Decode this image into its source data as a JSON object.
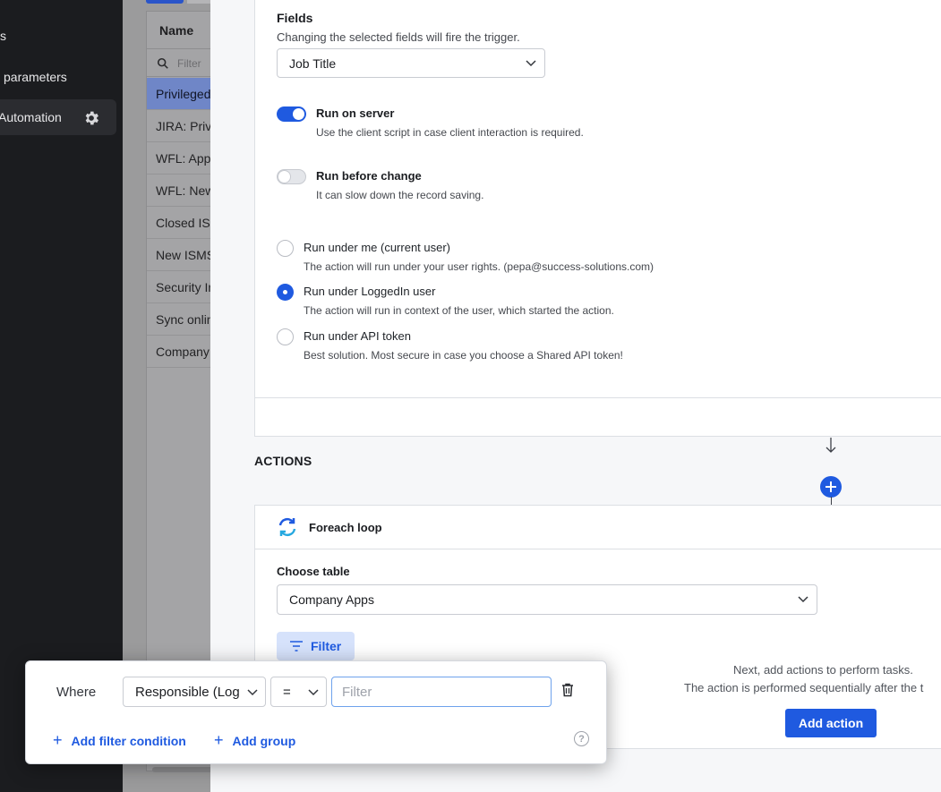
{
  "sidebar": {
    "items": [
      {
        "label": "s"
      },
      {
        "label": "parameters"
      },
      {
        "label": "Automation"
      }
    ]
  },
  "list": {
    "header": "Name",
    "filter_placeholder": "Filter",
    "rows": [
      "Privileged",
      "JIRA: Privi",
      "WFL: Appr",
      "WFL: New",
      "Closed ISM",
      "New ISMS",
      "Security In",
      "Sync onlin",
      "Company"
    ]
  },
  "trigger": {
    "fields_label": "Fields",
    "fields_hint": "Changing the selected fields will fire the trigger.",
    "fields_value": "Job Title",
    "run_on_server_label": "Run on server",
    "run_on_server_hint": "Use the client script in case client interaction is required.",
    "run_before_change_label": "Run before change",
    "run_before_change_hint": "It can slow down the record saving.",
    "run_options": [
      {
        "label": "Run under me (current user)",
        "hint": "The action will run under your user rights. (pepa@success-solutions.com)",
        "selected": false
      },
      {
        "label": "Run under LoggedIn user",
        "hint": "The action will run in context of the user, which started the action.",
        "selected": true
      },
      {
        "label": "Run under API token",
        "hint": "Best solution. Most secure in case you choose a Shared API token!",
        "selected": false
      }
    ]
  },
  "actions": {
    "title": "ACTIONS",
    "loop_title": "Foreach loop",
    "choose_table_label": "Choose table",
    "table_value": "Company Apps",
    "filter_button": "Filter",
    "next_text": "Next, add actions to perform tasks.",
    "sequential_text": "The action is performed sequentially after the t",
    "add_action_button": "Add action"
  },
  "popup": {
    "where_label": "Where",
    "field_value": "Responsible (Log",
    "operator_value": "=",
    "input_placeholder": "Filter",
    "add_condition": "Add filter condition",
    "add_group": "Add group",
    "help": "?"
  },
  "colors": {
    "accent": "#1f5ae0",
    "sidebar_bg": "#1b1c1f"
  }
}
